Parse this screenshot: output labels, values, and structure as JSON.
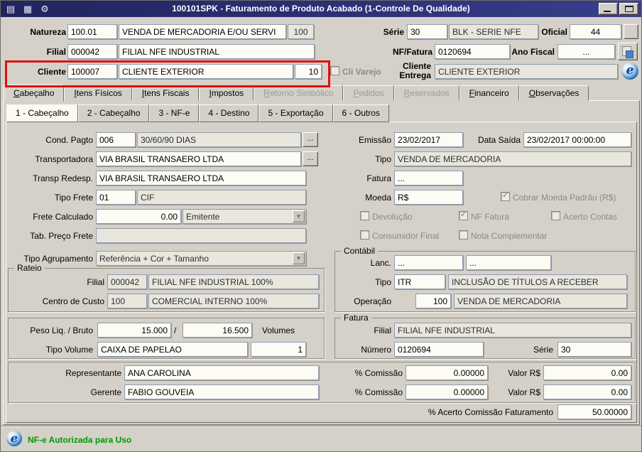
{
  "window": {
    "title": "100101SPK - Faturamento de Produto Acabado (1-Controle De Qualidade)"
  },
  "colors": {
    "titlebar": "#2b3078",
    "background": "#d5d1c9",
    "highlight_red": "#dd1111",
    "status_green": "#009900"
  },
  "icons": {
    "form": "▤",
    "modules": "▦",
    "tools": "⚙",
    "globe_letter": "e"
  },
  "ui": {
    "ellipsis_button": "...",
    "combo_arrow": "▼"
  },
  "header": {
    "natureza_label": "Natureza",
    "natureza_code": "100.01",
    "natureza_desc": "VENDA DE MERCADORIA E/OU SERVI",
    "natureza_extra": "100",
    "serie_label": "Série",
    "serie_code": "30",
    "serie_desc": "BLK - SERIE NFE",
    "oficial_label": "Oficial",
    "oficial_value": "44",
    "filial_label": "Filial",
    "filial_code": "000042",
    "filial_desc": "FILIAL NFE INDUSTRIAL",
    "nf_fatura_label": "NF/Fatura",
    "nf_fatura_value": "0120694",
    "ano_fiscal_label": "Ano Fiscal",
    "ano_fiscal_value": "...",
    "cliente_label": "Cliente",
    "cliente_code": "100007",
    "cliente_desc": "CLIENTE EXTERIOR",
    "cliente_loja": "10",
    "cli_varejo_label": "Cli Varejo",
    "cliente_entrega_label_1": "Cliente",
    "cliente_entrega_label_2": "Entrega",
    "cliente_entrega_value": "CLIENTE EXTERIOR"
  },
  "tabs": {
    "main": [
      {
        "label": "Cabeçalho",
        "active": true,
        "disabled": false
      },
      {
        "label": "Itens Físicos",
        "active": false,
        "disabled": false
      },
      {
        "label": "Itens Fiscais",
        "active": false,
        "disabled": false
      },
      {
        "label": "Impostos",
        "active": false,
        "disabled": false
      },
      {
        "label": "Retorno Simbólico",
        "active": false,
        "disabled": true
      },
      {
        "label": "Pedidos",
        "active": false,
        "disabled": true
      },
      {
        "label": "Reservados",
        "active": false,
        "disabled": true
      },
      {
        "label": "Financeiro",
        "active": false,
        "disabled": false
      },
      {
        "label": "Observações",
        "active": false,
        "disabled": false
      }
    ],
    "sub": [
      {
        "label": "1 - Cabeçalho",
        "active": true
      },
      {
        "label": "2 - Cabeçalho",
        "active": false
      },
      {
        "label": "3 - NF-e",
        "active": false
      },
      {
        "label": "4 - Destino",
        "active": false
      },
      {
        "label": "5 - Exportação",
        "active": false
      },
      {
        "label": "6 - Outros",
        "active": false
      }
    ]
  },
  "form": {
    "cond_pagto_label": "Cond. Pagto",
    "cond_pagto_code": "006",
    "cond_pagto_desc": "30/60/90 DIAS",
    "transportadora_label": "Transportadora",
    "transportadora_value": "VIA BRASIL TRANSAERO LTDA",
    "transp_redesp_label": "Transp Redesp.",
    "transp_redesp_value": "VIA BRASIL TRANSAERO LTDA",
    "tipo_frete_label": "Tipo Frete",
    "tipo_frete_code": "01",
    "tipo_frete_desc": "CIF",
    "frete_calculado_label": "Frete Calculado",
    "frete_calculado_value": "0.00",
    "frete_calculado_tipo": "Emitente",
    "tab_preco_frete_label": "Tab. Preço Frete",
    "tab_preco_frete_value": "",
    "tipo_agrupamento_label": "Tipo Agrupamento",
    "tipo_agrupamento_value": "Referência + Cor + Tamanho",
    "emissao_label": "Emissão",
    "emissao_value": "23/02/2017",
    "data_saida_label": "Data Saída",
    "data_saida_value": "23/02/2017 00:00:00",
    "tipo_label": "Tipo",
    "tipo_value": "VENDA DE MERCADORIA",
    "fatura_label": "Fatura",
    "fatura_value": "...",
    "moeda_label": "Moeda",
    "moeda_value": "R$",
    "chk_cobrar_moeda": "Cobrar Moeda Padrão (R$)",
    "chk_devolucao": "Devolução",
    "chk_nf_fatura": "NF Fatura",
    "chk_acerto_contas": "Acerto Contas",
    "chk_consumidor_final": "Consumidor Final",
    "chk_nota_complementar": "Nota Complementar"
  },
  "checkbox_states": {
    "cli_varejo": false,
    "cobrar_moeda": true,
    "devolucao": false,
    "nf_fatura": true,
    "acerto_contas": false,
    "consumidor_final": false,
    "nota_complementar": false
  },
  "rateio": {
    "title": "Rateio",
    "filial_label": "Filial",
    "filial_code": "000042",
    "filial_desc": "FILIAL NFE INDUSTRIAL 100%",
    "centro_custo_label": "Centro de Custo",
    "centro_custo_code": "100",
    "centro_custo_desc": "COMERCIAL INTERNO 100%"
  },
  "peso": {
    "peso_label": "Peso Liq. / Bruto",
    "liquido": "15.000",
    "separador": "/",
    "bruto": "16.500",
    "volumes_label": "Volumes",
    "tipo_volume_label": "Tipo Volume",
    "tipo_volume_value": "CAIXA DE PAPELAO",
    "volumes_value": "1"
  },
  "contabil": {
    "title": "Contábil",
    "lanc_label": "Lanc.",
    "lanc_value_1": "...",
    "lanc_value_2": "...",
    "tipo_label": "Tipo",
    "tipo_code": "ITR",
    "tipo_desc": "INCLUSÃO DE TÍTULOS A RECEBER",
    "operacao_label": "Operação",
    "operacao_code": "100",
    "operacao_desc": "VENDA DE MERCADORIA"
  },
  "fatura_box": {
    "title": "Fatura",
    "filial_label": "Filial",
    "filial_value": "FILIAL NFE INDUSTRIAL",
    "numero_label": "Número",
    "numero_value": "0120694",
    "serie_label": "Série",
    "serie_value": "30"
  },
  "comissao": {
    "representante_label": "Representante",
    "representante_value": "ANA CAROLINA",
    "gerente_label": "Gerente",
    "gerente_value": "FABIO GOUVEIA",
    "pct_comissao_label": "% Comissão",
    "representante_pct": "0.00000",
    "gerente_pct": "0.00000",
    "valor_label": "Valor R$",
    "representante_valor": "0.00",
    "gerente_valor": "0.00",
    "acerto_label": "% Acerto Comissão Faturamento",
    "acerto_value": "50.00000"
  },
  "statusbar": {
    "message": "NF-e Autorizada para Uso"
  }
}
